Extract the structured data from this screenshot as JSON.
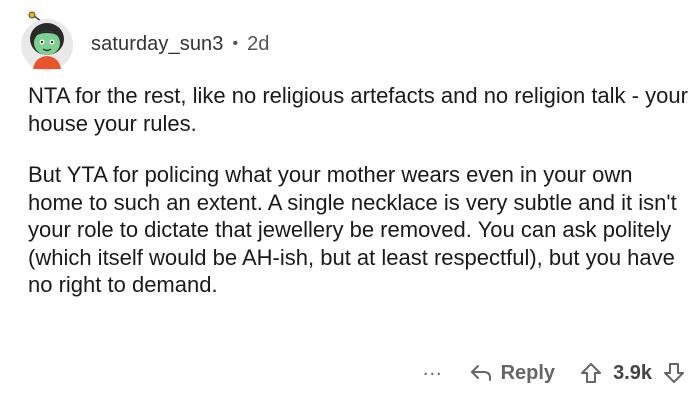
{
  "comment": {
    "username": "saturday_sun3",
    "separator": "•",
    "age": "2d",
    "paragraphs": [
      "NTA for the rest, like no religious artefacts and no religion talk - your house your rules.",
      "But YTA for policing what your mother wears even in your own home to such an extent. A single necklace is very subtle and it isn't your role to dictate that jewellery be removed. You can ask politely (which itself would be AH-ish, but at least respectful), but you have no right to demand."
    ]
  },
  "actions": {
    "more_label": "...",
    "reply_label": "Reply",
    "score": "3.9k",
    "icons": {
      "more": "more-dots-icon",
      "reply": "reply-arrow-icon",
      "upvote": "upvote-arrow-icon",
      "downvote": "downvote-arrow-icon"
    }
  },
  "colors": {
    "text": "#1a1a1b",
    "meta": "#555555",
    "avatar_bg": "#e8e8e8",
    "avatar_skin": "#7ed090",
    "avatar_hair": "#2a2a2a",
    "avatar_shirt": "#e8552b"
  }
}
